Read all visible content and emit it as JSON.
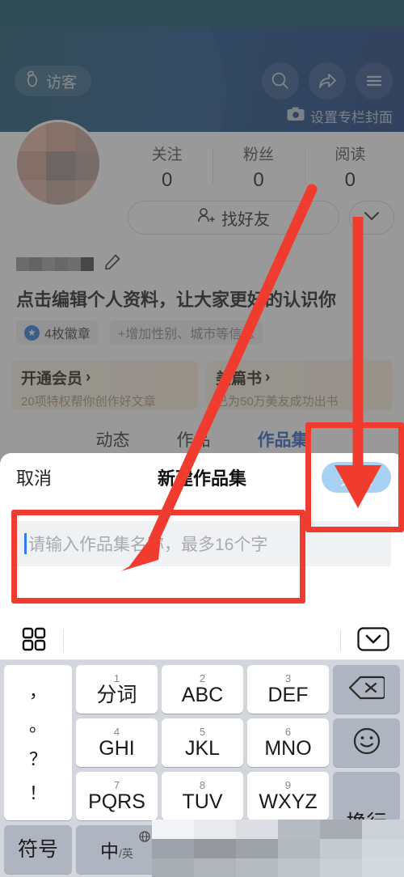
{
  "header": {
    "visitor_pill": {
      "label": "访客",
      "icon": "footprint-icon"
    },
    "icons": [
      "search-icon",
      "share-icon",
      "menu-icon"
    ],
    "cover_button": {
      "label": "设置专栏封面",
      "icon": "camera-icon"
    },
    "gradient_from": "#14506b",
    "gradient_to": "#1d3f7c",
    "statusbar_color": "#115466"
  },
  "profile": {
    "stats": [
      {
        "label": "关注",
        "value": "0"
      },
      {
        "label": "粉丝",
        "value": "0"
      },
      {
        "label": "阅读",
        "value": "0"
      }
    ],
    "find_friend_label": "找好友",
    "find_friend_icon": "add-friend-icon",
    "expand_icon": "chevron-down-icon",
    "edit_icon": "pencil-icon",
    "tagline": "点击编辑个人资料，让大家更好的认识你",
    "badge_label": "4枚徽章",
    "badge_icon": "star-badge-icon",
    "add_info_label": "+增加性别、城市等信息"
  },
  "promos": [
    {
      "title": "开通会员",
      "arrow": "›",
      "subtitle": "20项特权帮你创作好文章"
    },
    {
      "title": "美篇书",
      "arrow": "›",
      "subtitle": "已为50万美友成功出书"
    }
  ],
  "tabs": [
    {
      "label": "动态",
      "active": false
    },
    {
      "label": "作品",
      "active": false
    },
    {
      "label": "作品集",
      "active": true
    }
  ],
  "sheet": {
    "cancel_label": "取消",
    "title": "新建作品集",
    "done_label": "完成",
    "done_enabled": false,
    "done_bg": "#a9d1f2",
    "input_value": "",
    "input_placeholder": "请输入作品集名称，最多16个字"
  },
  "keyboard": {
    "toolbar": {
      "grid_icon": "grid-panel-icon",
      "collapse_icon": "keyboard-down-icon"
    },
    "punct_key": {
      "name": "punctuation-key",
      "glyphs": [
        "，",
        "。",
        "？",
        "！"
      ]
    },
    "keys": [
      {
        "num": "1",
        "main": "分词"
      },
      {
        "num": "2",
        "main": "ABC"
      },
      {
        "num": "3",
        "main": "DEF"
      },
      {
        "num": "4",
        "main": "GHI"
      },
      {
        "num": "5",
        "main": "JKL"
      },
      {
        "num": "6",
        "main": "MNO"
      },
      {
        "num": "7",
        "main": "PQRS"
      },
      {
        "num": "8",
        "main": "TUV"
      },
      {
        "num": "9",
        "main": "WXYZ"
      }
    ],
    "backspace_icon": "backspace-icon",
    "emoji_icon": "emoji-icon",
    "return_label": "换行",
    "symbol_label": "符号",
    "lang_main": "中",
    "lang_sub": "/英",
    "globe_icon": "globe-icon"
  },
  "annotations": {
    "color": "#f03c2e",
    "boxes": [
      "done-button-highlight",
      "input-field-highlight"
    ],
    "arrows": [
      "arrow-to-input",
      "arrow-to-done"
    ]
  }
}
